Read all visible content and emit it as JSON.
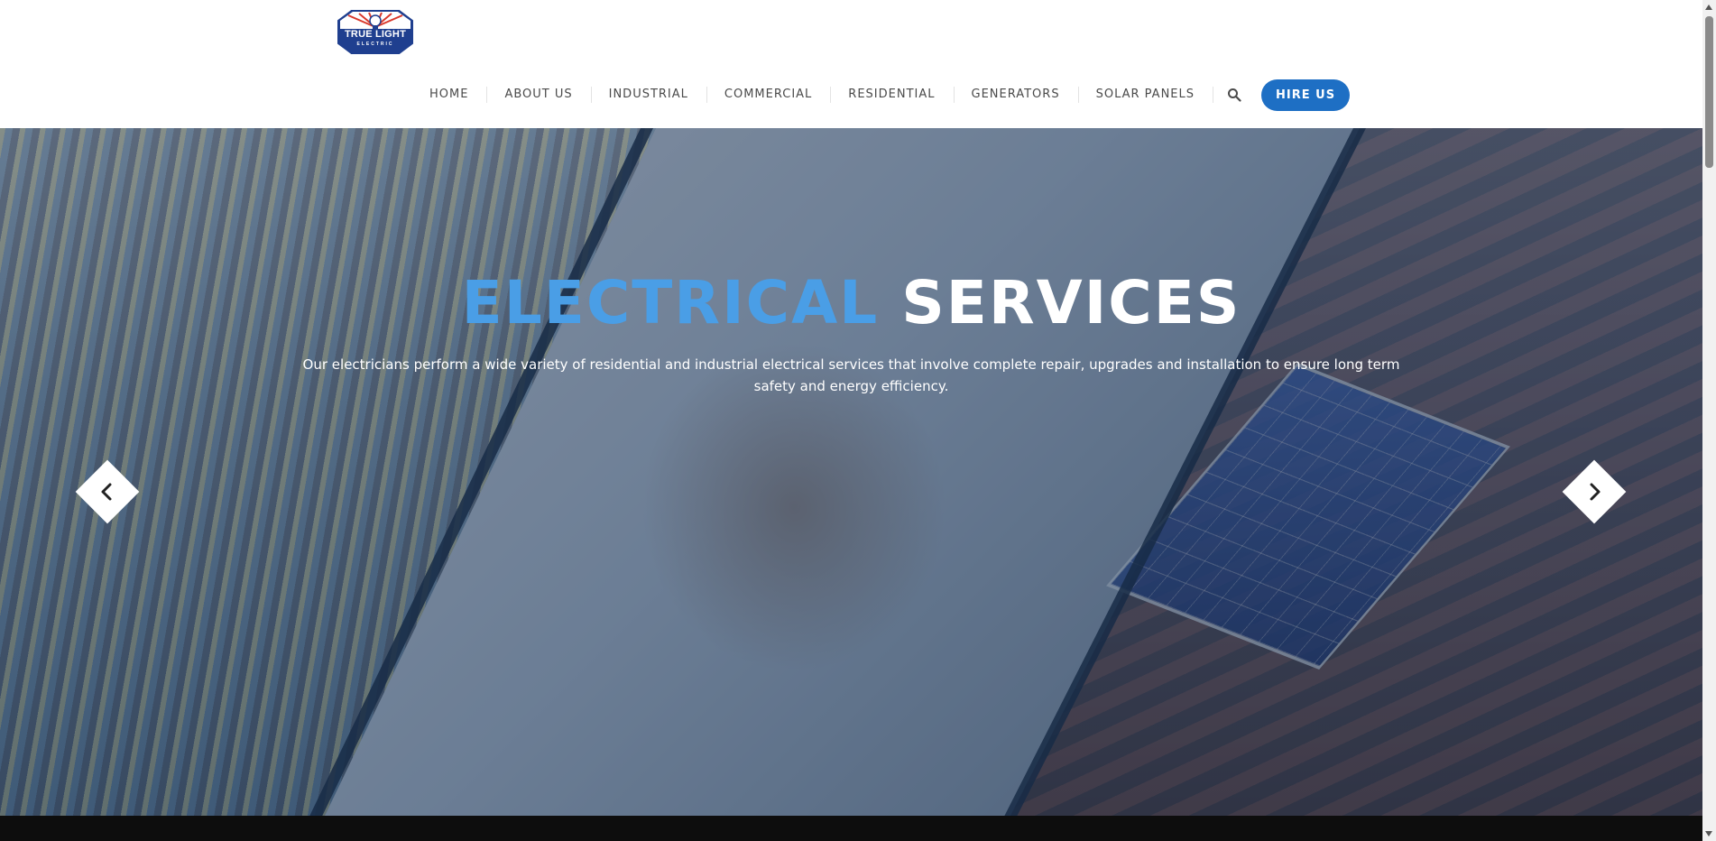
{
  "brand": {
    "logo_text": "TRUE LIGHT",
    "logo_subtext": "ELECTRIC"
  },
  "nav": {
    "items": [
      {
        "label": "HOME"
      },
      {
        "label": "ABOUT US"
      },
      {
        "label": "INDUSTRIAL"
      },
      {
        "label": "COMMERCIAL"
      },
      {
        "label": "RESIDENTIAL"
      },
      {
        "label": "GENERATORS"
      },
      {
        "label": "SOLAR PANELS"
      }
    ],
    "search_icon": "search-icon",
    "cta_label": "HIRE US"
  },
  "hero": {
    "title_accent": "ELECTRICAL",
    "title_rest": "SERVICES",
    "description": "Our electricians perform a wide variety of residential and industrial electrical services that involve complete repair, upgrades and installation to ensure long term safety and energy efficiency.",
    "prev_icon": "chevron-left-icon",
    "next_icon": "chevron-right-icon"
  },
  "colors": {
    "accent": "#4a9ee6",
    "button": "#1e6fc4",
    "logo_blue": "#1f3f8f",
    "logo_red": "#d9382b"
  }
}
